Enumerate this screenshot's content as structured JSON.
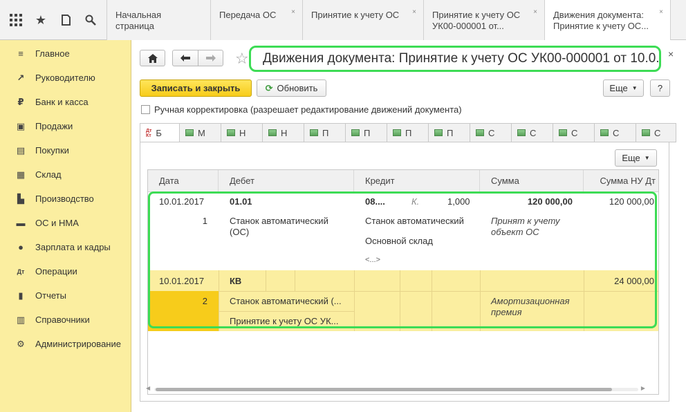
{
  "topbar": {
    "tabs": [
      {
        "label": "Начальная страница",
        "closable": false
      },
      {
        "label": "Передача ОС",
        "closable": true
      },
      {
        "label": "Принятие к учету ОС",
        "closable": true
      },
      {
        "label": "Принятие к учету ОС",
        "label2": "УК00-000001 от...",
        "closable": true
      },
      {
        "label": "Движения документа:",
        "label2": "Принятие к учету ОС...",
        "closable": true,
        "active": true
      }
    ],
    "close_glyph": "×"
  },
  "sidebar": {
    "items": [
      {
        "label": "Главное",
        "icon": "menu-icon",
        "glyph": "≡"
      },
      {
        "label": "Руководителю",
        "icon": "trend-icon",
        "glyph": "↗"
      },
      {
        "label": "Банк и касса",
        "icon": "ruble-icon",
        "glyph": "₽"
      },
      {
        "label": "Продажи",
        "icon": "bag-icon",
        "glyph": "▣"
      },
      {
        "label": "Покупки",
        "icon": "cart-icon",
        "glyph": "▤"
      },
      {
        "label": "Склад",
        "icon": "warehouse-icon",
        "glyph": "▦"
      },
      {
        "label": "Производство",
        "icon": "factory-icon",
        "glyph": "▙"
      },
      {
        "label": "ОС и НМА",
        "icon": "truck-icon",
        "glyph": "▬"
      },
      {
        "label": "Зарплата и кадры",
        "icon": "people-icon",
        "glyph": "●"
      },
      {
        "label": "Операции",
        "icon": "dtkt-icon",
        "glyph": "Дт"
      },
      {
        "label": "Отчеты",
        "icon": "bar-chart-icon",
        "glyph": "▮"
      },
      {
        "label": "Справочники",
        "icon": "book-icon",
        "glyph": "▥"
      },
      {
        "label": "Администрирование",
        "icon": "gear-icon",
        "glyph": "⚙"
      }
    ]
  },
  "main": {
    "title": "Движения документа: Принятие к учету ОС УК00-000001 от 10.0...",
    "write_close_label": "Записать и закрыть",
    "refresh_label": "Обновить",
    "more_label": "Еще",
    "help_label": "?",
    "manual_label": "Ручная корректировка (разрешает редактирование движений документа)",
    "tabs": [
      "Б",
      "М",
      "Н",
      "Н",
      "П",
      "П",
      "П",
      "П",
      "С",
      "С",
      "С",
      "С",
      "С"
    ],
    "grid_more_label": "Еще",
    "columns": [
      "Дата",
      "Дебет",
      "Кредит",
      "Сумма",
      "Сумма НУ Дт"
    ],
    "rows": [
      {
        "date": "10.01.2017",
        "num": "1",
        "debit_account": "01.01",
        "debit_sub1": "Станок автоматический",
        "debit_sub1b": "(ОС)",
        "credit_account": "08....",
        "credit_qty_label": "К.",
        "credit_qty": "1,000",
        "credit_sub1": "Станок автоматический",
        "credit_sub2": "Основной склад",
        "credit_sub3": "<...>",
        "sum": "120 000,00",
        "content": "Принят к учету",
        "content2": "объект ОС",
        "sum_nu": "120 000,00"
      },
      {
        "date": "10.01.2017",
        "num": "2",
        "debit_account": "КВ",
        "debit_sub1": "Станок автоматический (...",
        "debit_sub2": "Принятие к учету ОС УК...",
        "content": "Амортизационная",
        "content2": "премия",
        "sum_nu": "24 000,00"
      }
    ]
  }
}
